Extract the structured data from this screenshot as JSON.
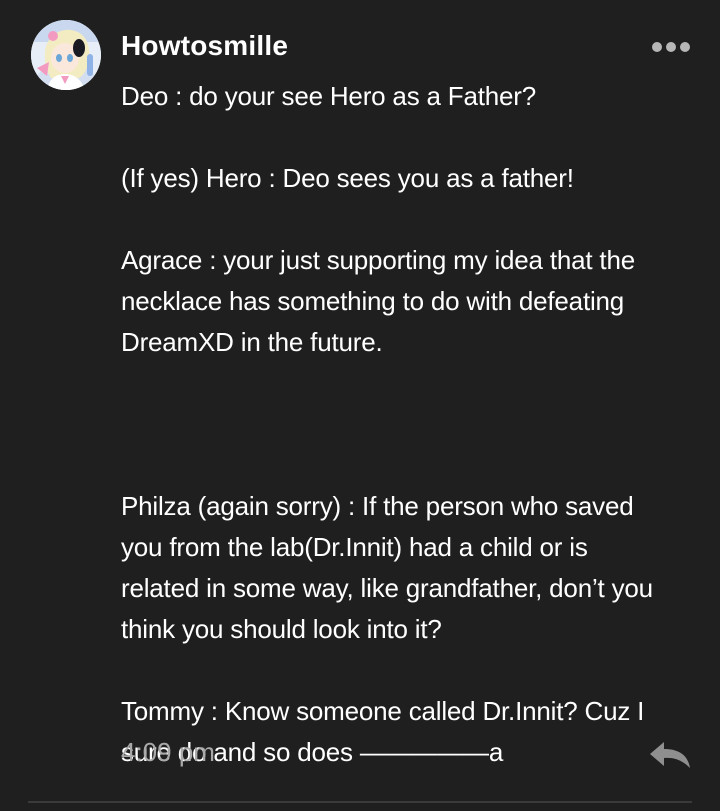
{
  "post": {
    "username": "Howtosmille",
    "more_icon": "more-horizontal-icon",
    "lines": {
      "l1": "Deo : do your see Hero as a Father?",
      "l2": "(If yes) Hero : Deo sees you as a father!",
      "l3": "Agrace : your just supporting my idea that the",
      "l4": "necklace has something to do with defeating",
      "l5": "DreamXD in the future.",
      "l6": "Philza (again sorry) : If the person who saved",
      "l7": "you from the lab(Dr.Innit) had a child or is",
      "l8": "related in some way, like grandfather, don’t you",
      "l9": "think you should look into it?",
      "l10": "Tommy : Know someone called Dr.Innit? Cuz I",
      "l11": "sure do and so does —————a"
    },
    "timestamp": "4:09 pm",
    "reply_icon": "reply-icon",
    "colors": {
      "background": "#1f1f1f",
      "text": "#ffffff",
      "muted": "#a9a9a9"
    }
  }
}
